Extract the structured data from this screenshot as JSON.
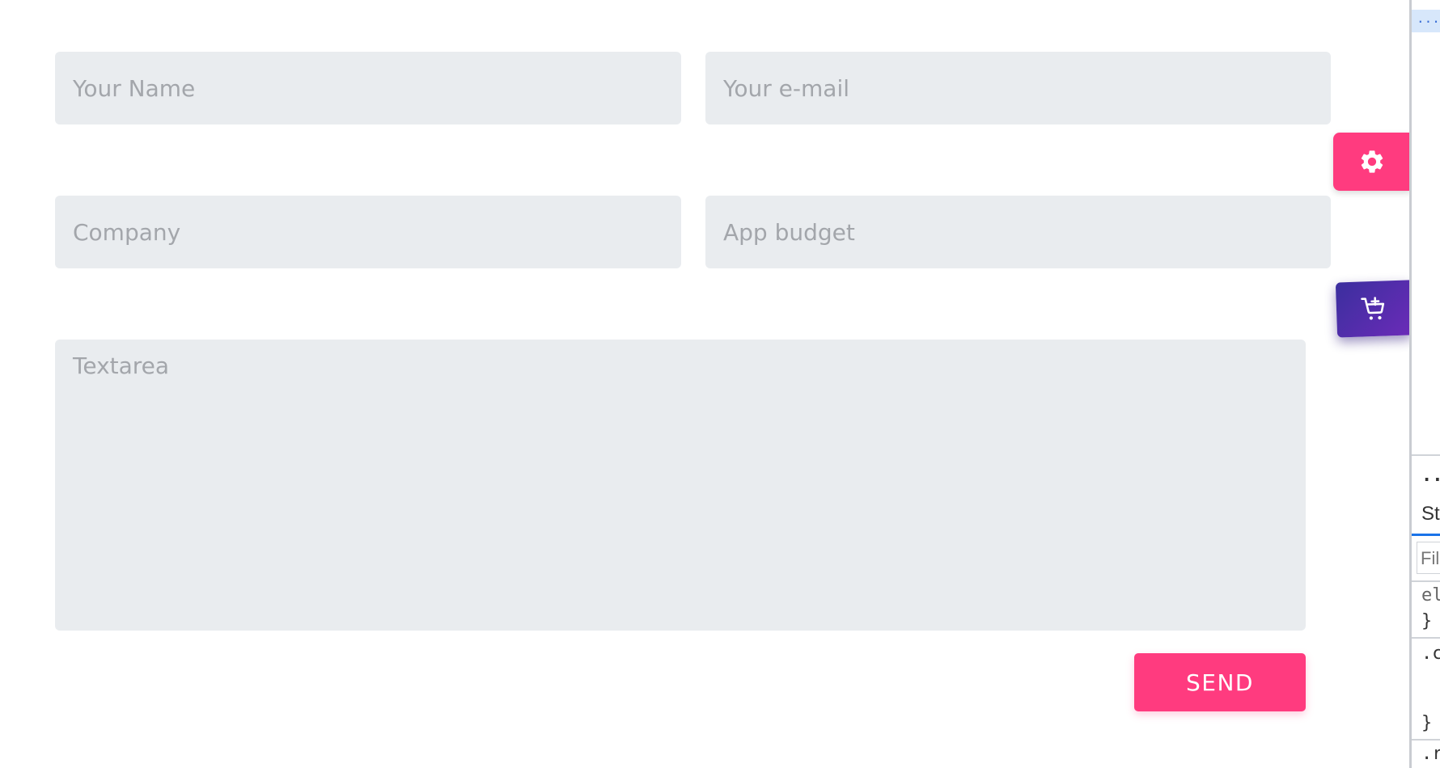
{
  "form": {
    "name_placeholder": "Your Name",
    "email_placeholder": "Your e-mail",
    "company_placeholder": "Company",
    "budget_placeholder": "App budget",
    "textarea_placeholder": "Textarea",
    "send_label": "SEND"
  },
  "floating_buttons": {
    "settings_icon": "gear-icon",
    "cart_icon": "add-to-cart-icon"
  },
  "devtools": {
    "top_label": "...",
    "more_label": "...",
    "tab_label": "St",
    "filter_placeholder": "Fil",
    "rule1_selector": "el",
    "rule1_close": "}",
    "rule2_selector": ".c",
    "rule2_close": "}",
    "rule3_selector": ".r"
  },
  "colors": {
    "accent_pink": "#ff3b7f",
    "cart_gradient_start": "#3b2f9e",
    "cart_gradient_end": "#6b2bb8",
    "field_background": "#e9ecef",
    "placeholder_text": "#a3a6ab"
  }
}
